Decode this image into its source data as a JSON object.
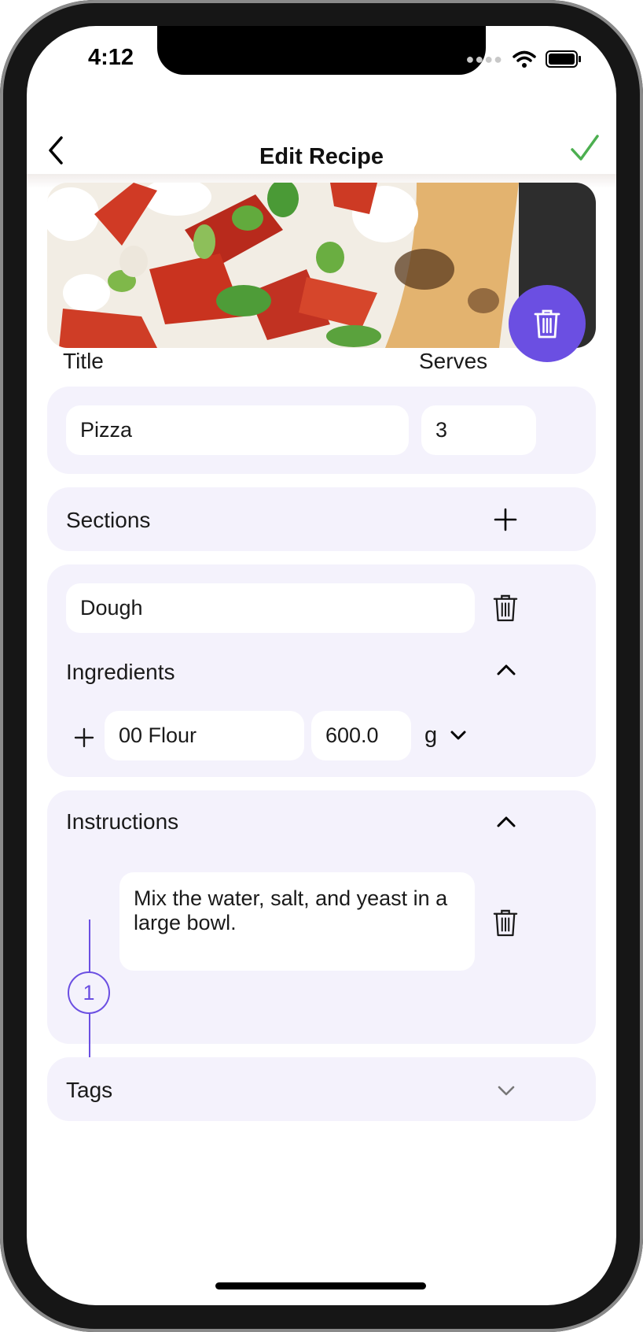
{
  "status_bar": {
    "time": "4:12"
  },
  "header": {
    "title": "Edit Recipe"
  },
  "colors": {
    "accent": "#6b4fe2",
    "confirm": "#4caf50",
    "card_bg": "#f4f2fc"
  },
  "labels": {
    "title": "Title",
    "serves": "Serves"
  },
  "recipe": {
    "title_value": "Pizza",
    "serves_value": "3"
  },
  "sections": {
    "label": "Sections"
  },
  "section": {
    "name_value": "Dough",
    "ingredients_label": "Ingredients",
    "ingredient": {
      "name": "00 Flour",
      "amount": "600.0",
      "unit": "g"
    }
  },
  "instructions": {
    "label": "Instructions",
    "steps": [
      {
        "number": "1",
        "text": "Mix the water, salt, and yeast in a large bowl."
      }
    ]
  },
  "tags": {
    "label": "Tags"
  },
  "icons": [
    "back-icon",
    "check-icon",
    "trash-icon",
    "plus-icon",
    "chevron-up-icon",
    "chevron-down-icon",
    "wifi-icon",
    "battery-icon"
  ]
}
